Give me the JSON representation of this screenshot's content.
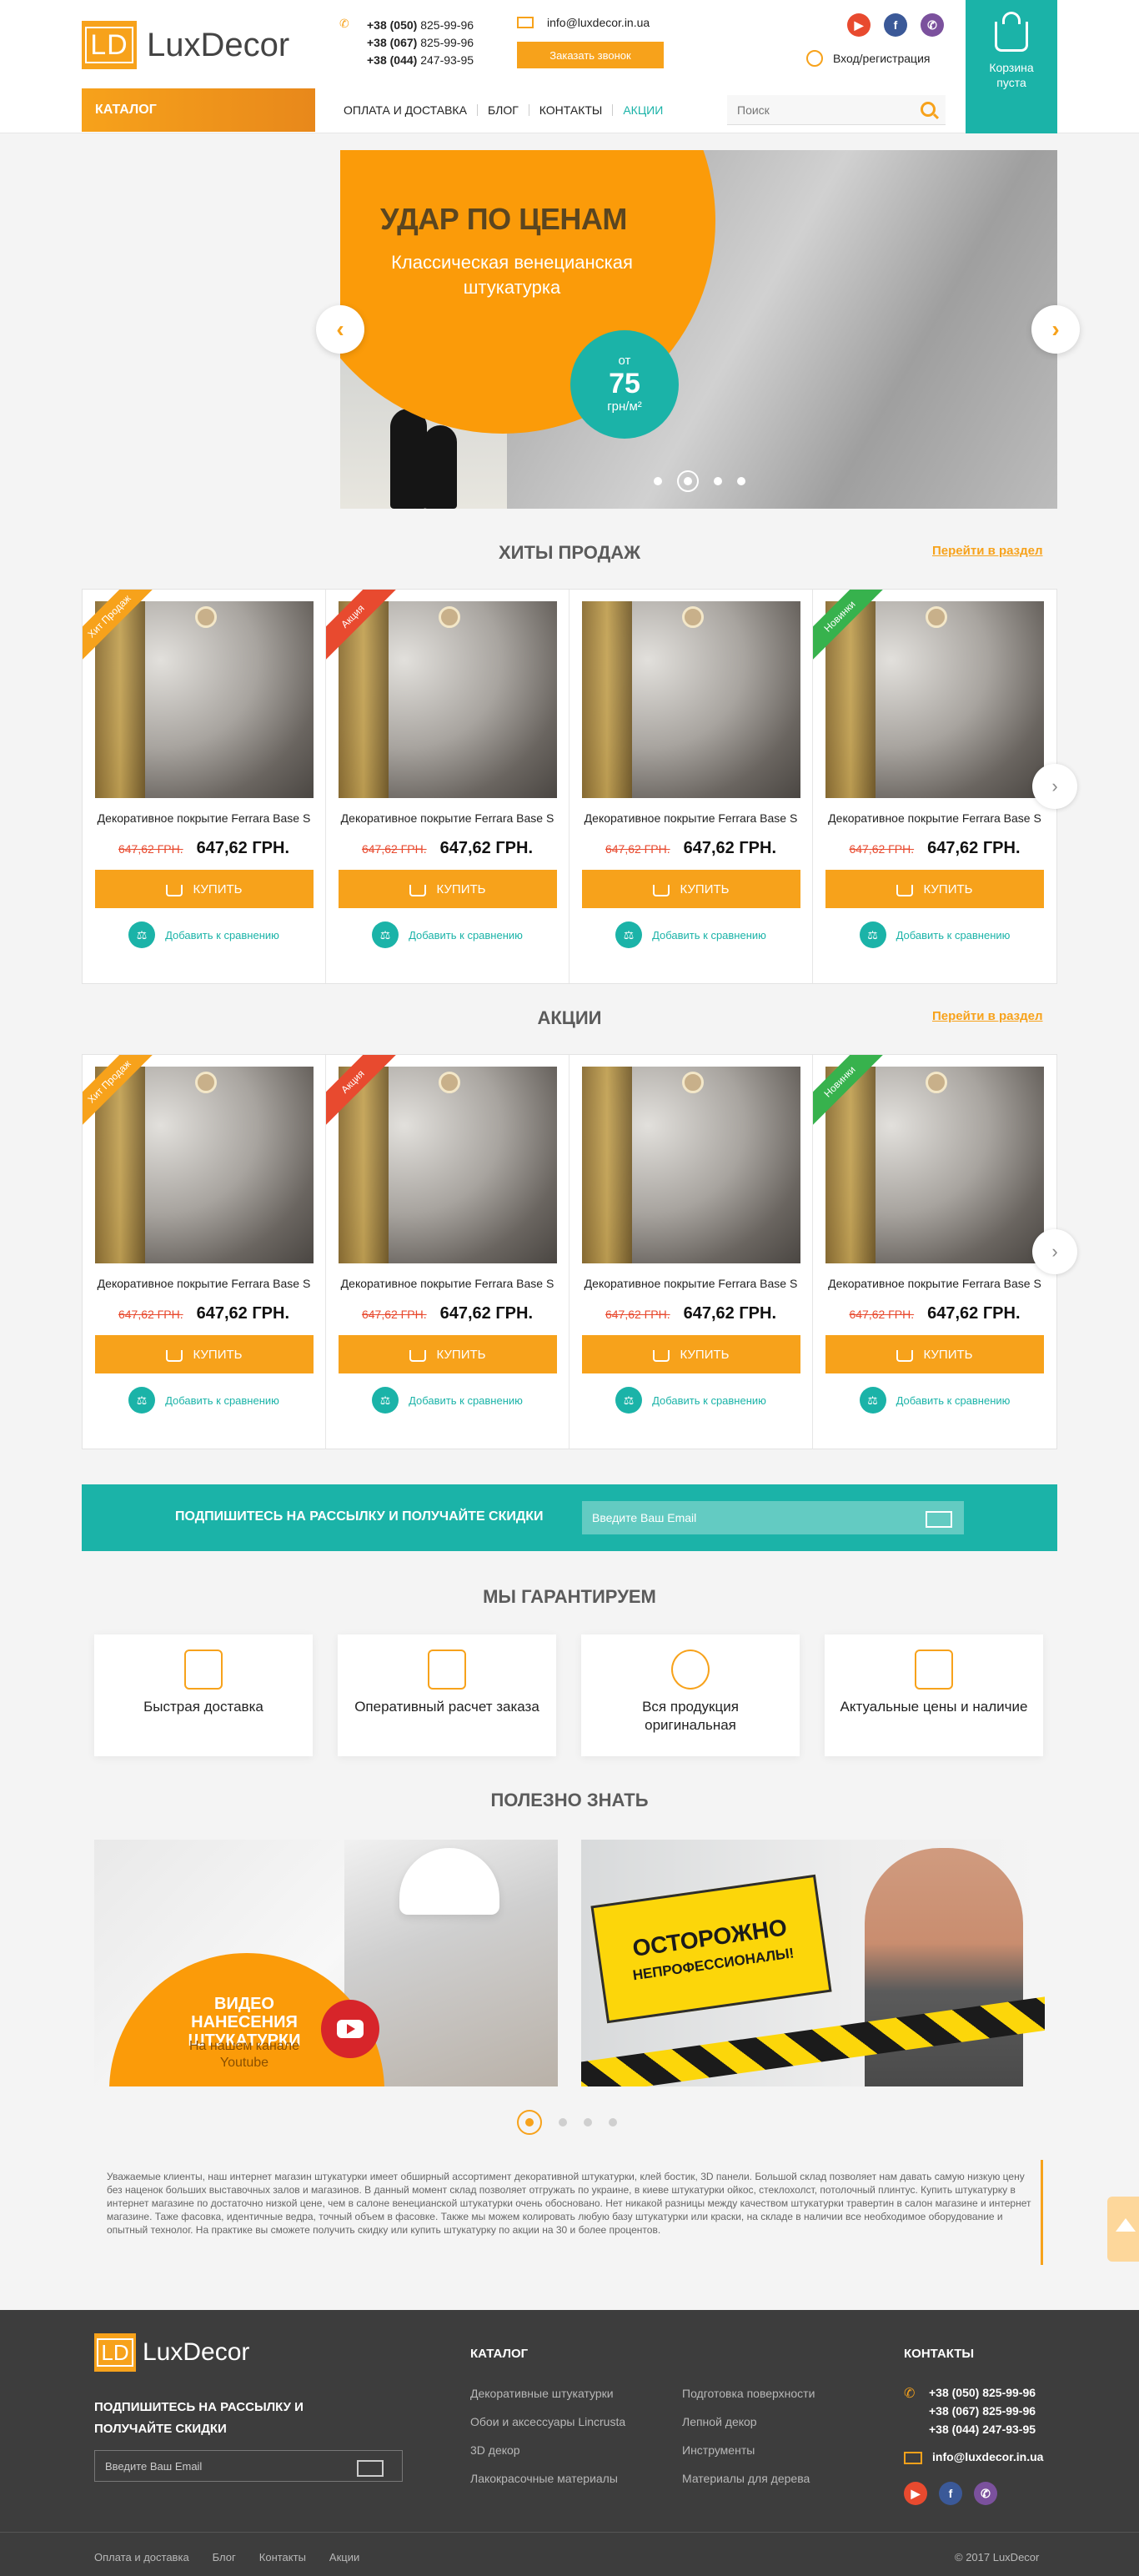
{
  "header": {
    "logo_mark": "LD",
    "logo_text": "LuxDecor",
    "phones": [
      {
        "code": "+38 (050)",
        "num": "825-99-96"
      },
      {
        "code": "+38 (067)",
        "num": "825-99-96"
      },
      {
        "code": "+38 (044)",
        "num": "247-93-95"
      }
    ],
    "email": "info@luxdecor.in.ua",
    "callback_label": "Заказать звонок",
    "login_label": "Вход/регистрация",
    "cart_label": "Корзина пуста",
    "catalog_label": "КАТАЛОГ",
    "nav": [
      "ОПЛАТА И ДОСТАВКА",
      "БЛОГ",
      "КОНТАКТЫ",
      "АКЦИИ"
    ],
    "search_placeholder": "Поиск"
  },
  "hero": {
    "title": "УДАР ПО ЦЕНАМ",
    "subtitle": "Классическая венецианская штукатурка",
    "price_from": "от",
    "price": "75",
    "price_unit": "грн/м²"
  },
  "sections": {
    "hits_title": "ХИТЫ ПРОДАЖ",
    "sale_title": "АКЦИИ",
    "goto_link": "Перейти в раздел"
  },
  "products": [
    {
      "badge": "Хит Продаж",
      "badge_type": "hit",
      "name": "Декоративное покрытие Ferrara Base S",
      "old_price": "647,62 ГРН.",
      "price": "647,62 ГРН.",
      "buy": "КУПИТЬ",
      "compare": "Добавить к сравнению"
    },
    {
      "badge": "Акция",
      "badge_type": "sale",
      "name": "Декоративное покрытие Ferrara Base S",
      "old_price": "647,62 ГРН.",
      "price": "647,62 ГРН.",
      "buy": "КУПИТЬ",
      "compare": "Добавить к сравнению"
    },
    {
      "badge": "",
      "badge_type": "none",
      "name": "Декоративное покрытие Ferrara Base S",
      "old_price": "647,62 ГРН.",
      "price": "647,62 ГРН.",
      "buy": "КУПИТЬ",
      "compare": "Добавить к сравнению"
    },
    {
      "badge": "Новинки",
      "badge_type": "new",
      "name": "Декоративное покрытие Ferrara Base S",
      "old_price": "647,62 ГРН.",
      "price": "647,62 ГРН.",
      "buy": "КУПИТЬ",
      "compare": "Добавить к сравнению"
    }
  ],
  "subscribe": {
    "text": "ПОДПИШИТЕСЬ НА РАССЫЛКУ И ПОЛУЧАЙТЕ СКИДКИ",
    "placeholder": "Введите Ваш Email"
  },
  "guarantee": {
    "title": "МЫ ГАРАНТИРУЕМ",
    "items": [
      {
        "icon": "truck-icon",
        "text": "Быстрая доставка"
      },
      {
        "icon": "calculator-icon",
        "text": "Оперативный расчет заказа"
      },
      {
        "icon": "medal-icon",
        "text": "Вся продукция оригинальная"
      },
      {
        "icon": "price-tag-icon",
        "text": "Актуальные цены и наличие"
      }
    ]
  },
  "useful": {
    "title": "ПОЛЕЗНО ЗНАТЬ",
    "card1_title": "ВИДЕО НАНЕСЕНИЯ ШТУКАТУРКИ",
    "card1_sub": "На нашем канале Youtube",
    "card2_title": "ОСТОРОЖНО",
    "card2_sub": "НЕПРОФЕССИОНАЛЫ!"
  },
  "seo_text": "Уважаемые клиенты, наш интернет магазин штукатурки имеет обширный ассортимент декоративной штукатурки, клей бостик, 3D панели. Большой склад позволяет нам давать самую низкую цену без наценок больших выставочных залов и магазинов. В данный момент склад позволяет отгружать по украине, в киеве штукатурки ойкос, стеклохолст, потолочный плинтус. Купить штукатурку в интернет магазине по достаточно низкой цене, чем в салоне венецианской штукатурки очень обосновано. Нет никакой разницы между качеством штукатурки травертин в салон магазине и интернет магазине. Таже фасовка, идентичные ведра, точный объем в фасовке. Также мы можем колировать любую базу штукатурки или краски, на складе в наличии все необходимое оборудование и опытный технолог. На практике вы сможете получить скидку или купить штукатурку по акции на 30 и более процентов.",
  "footer": {
    "logo_mark": "LD",
    "logo_text": "LuxDecor",
    "subscribe_text": "ПОДПИШИТЕСЬ НА РАССЫЛКУ И ПОЛУЧАЙТЕ СКИДКИ",
    "email_placeholder": "Введите Ваш Email",
    "catalog_title": "КАТАЛОГ",
    "catalog_col1": [
      "Декоративные штукатурки",
      "Обои и аксессуары Lincrusta",
      "3D декор",
      "Лакокрасочные материалы"
    ],
    "catalog_col2": [
      "Подготовка поверхности",
      "Лепной декор",
      "Инструменты",
      "Материалы для дерева"
    ],
    "contacts_title": "КОНТАКТЫ",
    "phones": [
      "+38 (050) 825-99-96",
      "+38 (067) 825-99-96",
      "+38 (044) 247-93-95"
    ],
    "email": "info@luxdecor.in.ua",
    "bottom_links": [
      "Оплата и доставка",
      "Блог",
      "Контакты",
      "Акции"
    ],
    "copyright": "© 2017 LuxDecor"
  },
  "colors": {
    "accent_orange": "#f7a21b",
    "accent_teal": "#1bb3a8",
    "sale_red": "#e84a2f",
    "new_green": "#37b24d",
    "footer_bg": "#3d3d3d"
  }
}
